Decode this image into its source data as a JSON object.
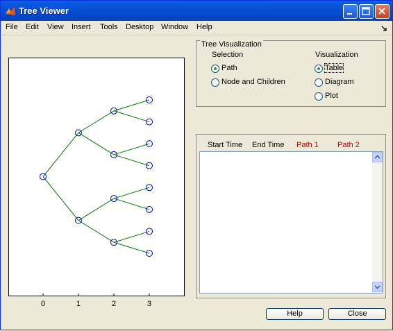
{
  "window": {
    "title": "Tree Viewer"
  },
  "menubar": {
    "items": [
      "File",
      "Edit",
      "View",
      "Insert",
      "Tools",
      "Desktop",
      "Window",
      "Help"
    ]
  },
  "plot": {
    "x_ticks": [
      "0",
      "1",
      "2",
      "3"
    ],
    "node_color": "#0000cc",
    "edge_color": "#008000"
  },
  "tree_visualization": {
    "title": "Tree Visualization",
    "selection": {
      "label": "Selection",
      "options": [
        "Path",
        "Node and Children"
      ],
      "selected": "Path"
    },
    "visualization": {
      "label": "Visualization",
      "options": [
        "Table",
        "Diagram",
        "Plot"
      ],
      "selected": "Table"
    }
  },
  "table": {
    "columns": [
      "Start Time",
      "End Time",
      "Path 1",
      "Path 2"
    ]
  },
  "buttons": {
    "help": "Help",
    "close": "Close"
  }
}
